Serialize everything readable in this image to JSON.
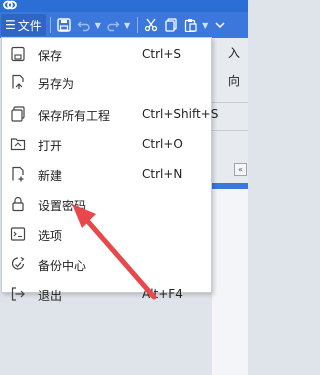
{
  "toolbar": {
    "file_label": "文件",
    "file_icon": "hamburger-icon",
    "icons": [
      "save-icon",
      "undo-icon",
      "redo-icon",
      "cut-icon",
      "copy-icon",
      "paste-icon"
    ]
  },
  "background": {
    "right_row1": "入",
    "right_row2": "向",
    "chevron": "«"
  },
  "menu": {
    "items": [
      {
        "label": "保存",
        "shortcut": "Ctrl+S",
        "icon": "save-icon"
      },
      {
        "label": "另存为",
        "shortcut": "",
        "icon": "save-as-icon"
      },
      {
        "label": "保存所有工程",
        "shortcut": "Ctrl+Shift+S",
        "icon": "save-all-icon"
      },
      {
        "label": "打开",
        "shortcut": "Ctrl+O",
        "icon": "open-folder-icon"
      },
      {
        "label": "新建",
        "shortcut": "Ctrl+N",
        "icon": "new-file-icon"
      },
      {
        "label": "设置密码",
        "shortcut": "",
        "icon": "lock-icon"
      },
      {
        "label": "选项",
        "shortcut": "",
        "icon": "options-icon"
      },
      {
        "label": "备份中心",
        "shortcut": "",
        "icon": "backup-icon"
      },
      {
        "label": "退出",
        "shortcut": "Alt+F4",
        "icon": "exit-icon"
      }
    ]
  },
  "colors": {
    "ribbon": "#3c78dc",
    "titlebar": "#2b6fd6",
    "arrow": "#e8474b"
  }
}
